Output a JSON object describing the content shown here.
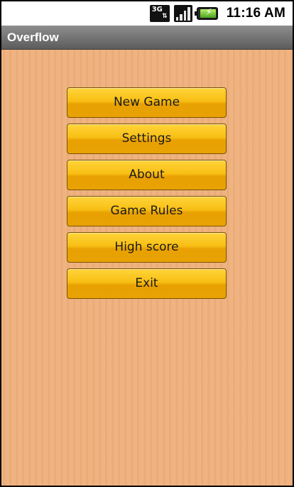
{
  "status_bar": {
    "network_label": "3G",
    "network_icon": "3g-icon",
    "signal_icon": "signal-strength-icon",
    "battery_icon": "battery-charging-icon",
    "time": "11:16 AM"
  },
  "app": {
    "title": "Overflow"
  },
  "menu": {
    "items": [
      {
        "label": "New Game"
      },
      {
        "label": "Settings"
      },
      {
        "label": "About"
      },
      {
        "label": "Game Rules"
      },
      {
        "label": "High score"
      },
      {
        "label": "Exit"
      }
    ]
  },
  "colors": {
    "background": "#efb07c",
    "button": "#f8bf14",
    "title_bar": "#707070"
  }
}
